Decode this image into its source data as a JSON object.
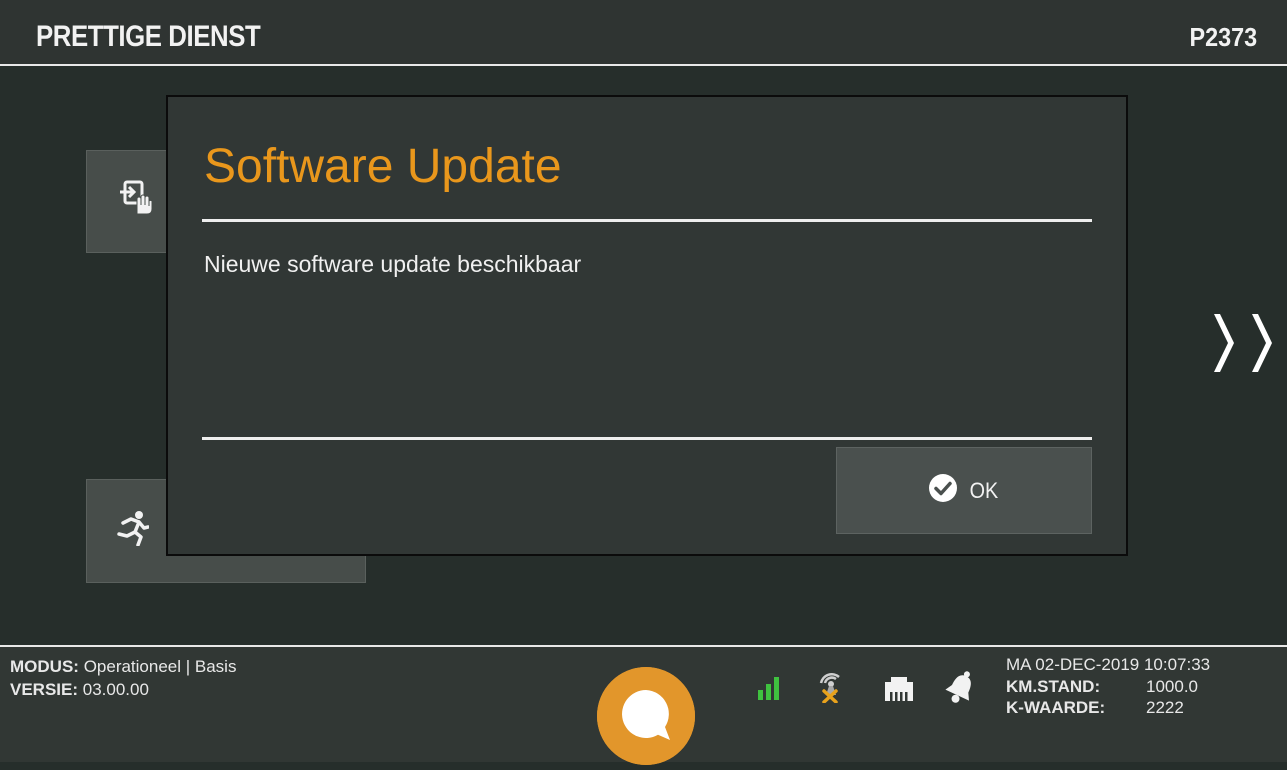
{
  "header": {
    "title": "PRETTIGE DIENST",
    "vehicle_id": "P2373"
  },
  "tiles": [
    {
      "icon": "login-hand-icon"
    },
    {
      "icon": "running-person-icon"
    }
  ],
  "modal": {
    "title": "Software Update",
    "message": "Nieuwe software update beschikbaar",
    "ok_label": "OK",
    "ok_icon": "check-circle-icon"
  },
  "footer": {
    "mode_label": "MODUS:",
    "mode_value": "Operationeel | Basis",
    "version_label": "VERSIE:",
    "version_value": "03.00.00",
    "datetime": "MA 02-DEC-2019 10:07:33",
    "km_label": "KM.STAND:",
    "km_value": "1000.0",
    "k_label": "K-WAARDE:",
    "k_value": "2222",
    "status_icons": [
      "signal-strength-icon",
      "gps-error-icon",
      "network-icon",
      "bell-icon"
    ]
  },
  "colors": {
    "accent": "#e9971c",
    "logo": "#e2962b",
    "signal": "#3fc23f"
  }
}
